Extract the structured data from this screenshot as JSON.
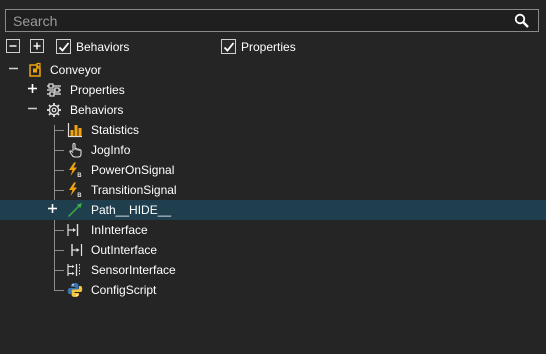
{
  "search": {
    "placeholder": "Search",
    "icon": "search-icon"
  },
  "toolbar": {
    "collapse_icon": "collapse-all-icon",
    "expand_icon": "expand-all-icon",
    "behaviors_label": "Behaviors",
    "behaviors_checked": true,
    "properties_label": "Properties",
    "properties_checked": true
  },
  "tree": {
    "root": {
      "label": "Conveyor",
      "icon": "component-icon",
      "expanded": true
    },
    "properties": {
      "label": "Properties",
      "icon": "sliders-icon",
      "expanded": false
    },
    "behaviors": {
      "label": "Behaviors",
      "icon": "gear-icon",
      "expanded": true
    },
    "items": [
      {
        "label": "Statistics",
        "icon": "bar-chart-icon"
      },
      {
        "label": "JogInfo",
        "icon": "hand-pointer-icon"
      },
      {
        "label": "PowerOnSignal",
        "icon": "lightning-boolean-icon"
      },
      {
        "label": "TransitionSignal",
        "icon": "lightning-boolean-icon"
      },
      {
        "label": "Path__HIDE__",
        "icon": "path-arrow-icon",
        "selected": true,
        "expandable": true
      },
      {
        "label": "InInterface",
        "icon": "in-interface-icon"
      },
      {
        "label": "OutInterface",
        "icon": "out-interface-icon"
      },
      {
        "label": "SensorInterface",
        "icon": "sensor-interface-icon"
      },
      {
        "label": "ConfigScript",
        "icon": "python-icon"
      }
    ]
  },
  "colors": {
    "background": "#252526",
    "selection": "#1f3f4f",
    "accent_orange": "#f0a30a",
    "accent_green": "#3cb043"
  }
}
